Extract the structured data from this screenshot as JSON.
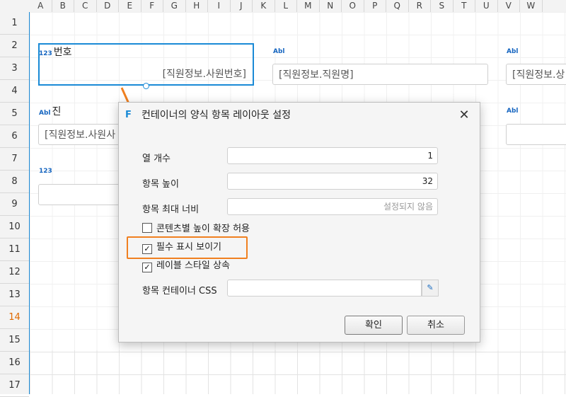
{
  "columns": [
    "A",
    "B",
    "C",
    "D",
    "E",
    "F",
    "G",
    "H",
    "I",
    "J",
    "K",
    "L",
    "M",
    "N",
    "O",
    "P",
    "Q",
    "R",
    "S",
    "T",
    "U",
    "V",
    "W"
  ],
  "rows": [
    "1",
    "2",
    "3",
    "4",
    "5",
    "6",
    "7",
    "8",
    "9",
    "10",
    "11",
    "12",
    "13",
    "14",
    "15",
    "16",
    "17"
  ],
  "active_row": "14",
  "form": {
    "emp_no_label": "번호",
    "emp_no_value": "[직원정보.사원번호]",
    "emp_name_value": "[직원정보.직원명]",
    "emp_extra_value": "[직원정보.상",
    "photo_label": "진",
    "photo_value": "[직원정보.사원사",
    "icon_tag": "Abl",
    "icon_tag2": "123"
  },
  "dialog": {
    "title": "컨테이너의 양식 항목 레이아웃 설정",
    "close_label": "✕",
    "column_count_label": "열 개수",
    "column_count_value": "1",
    "item_height_label": "항목 높이",
    "item_height_value": "32",
    "item_max_width_label": "항목 최대 너비",
    "item_max_width_placeholder": "설정되지 않음",
    "allow_content_height_label": "콘텐츠별 높이 확장 허용",
    "allow_content_height_checked": false,
    "show_required_label": "필수 표시 보이기",
    "show_required_checked": true,
    "inherit_label_style_label": "레이블 스타일 상속",
    "inherit_label_style_checked": true,
    "item_container_css_label": "항목 컨테이너 CSS",
    "ok_label": "확인",
    "cancel_label": "취소"
  },
  "colors": {
    "selection": "#1a8ad6",
    "highlight": "#f08020",
    "active_row": "#e06a00"
  }
}
